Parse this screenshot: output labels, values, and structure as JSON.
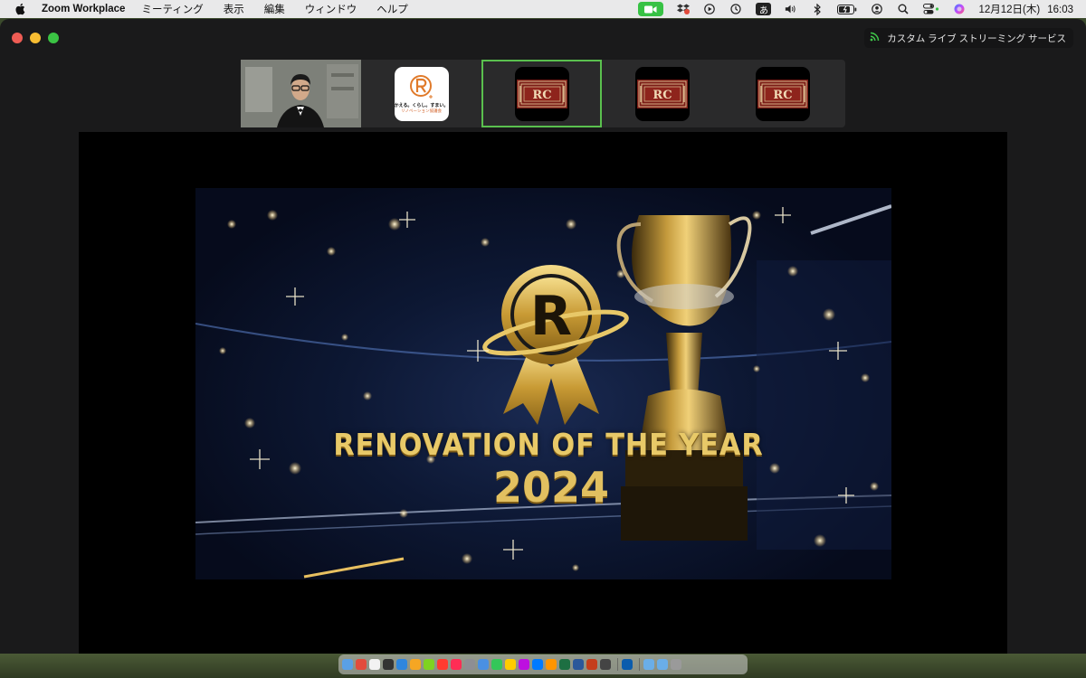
{
  "menubar": {
    "app_name": "Zoom Workplace",
    "menus": [
      "ミーティング",
      "表示",
      "編集",
      "ウィンドウ",
      "ヘルプ"
    ],
    "ime_label": "あ",
    "date": "12月12日(木)",
    "time": "16:03"
  },
  "window": {
    "streaming_label": "カスタム ライブ ストリーミング サービス"
  },
  "participants": [
    {
      "type": "video",
      "name_icon": "person-video"
    },
    {
      "type": "logo",
      "logo_line1": "かえる。くらし。すまい。",
      "logo_line2": "リノベーション協議会"
    },
    {
      "type": "rc-logo",
      "active": true,
      "logo_text": "RC"
    },
    {
      "type": "rc-logo",
      "logo_text": "RC"
    },
    {
      "type": "rc-logo",
      "logo_text": "RC"
    }
  ],
  "share": {
    "title": "RENOVATION OF THE YEAR",
    "year": "2024",
    "emblem_letter": "R"
  },
  "colors": {
    "facetime_green": "#37c244",
    "active_border": "#5ac04e",
    "gold": "#e2c060",
    "rc_red": "#8a1f1a"
  },
  "dock": {
    "app_colors": [
      "#5aa0e6",
      "#e24c3c",
      "#f2f2f2",
      "#333",
      "#2e86de",
      "#f5a623",
      "#7ed321",
      "#ff3b30",
      "#ff2d55",
      "#8e8e93",
      "#4a90e2",
      "#34c759",
      "#ffcc00",
      "#bd10e0",
      "#007aff",
      "#ff9500",
      "#1d6f42",
      "#2b579a",
      "#c43e1c",
      "#444",
      "#0b5cad"
    ],
    "right_colors": [
      "#6aaee8",
      "#6aaee8",
      "#9a9a9a"
    ]
  }
}
